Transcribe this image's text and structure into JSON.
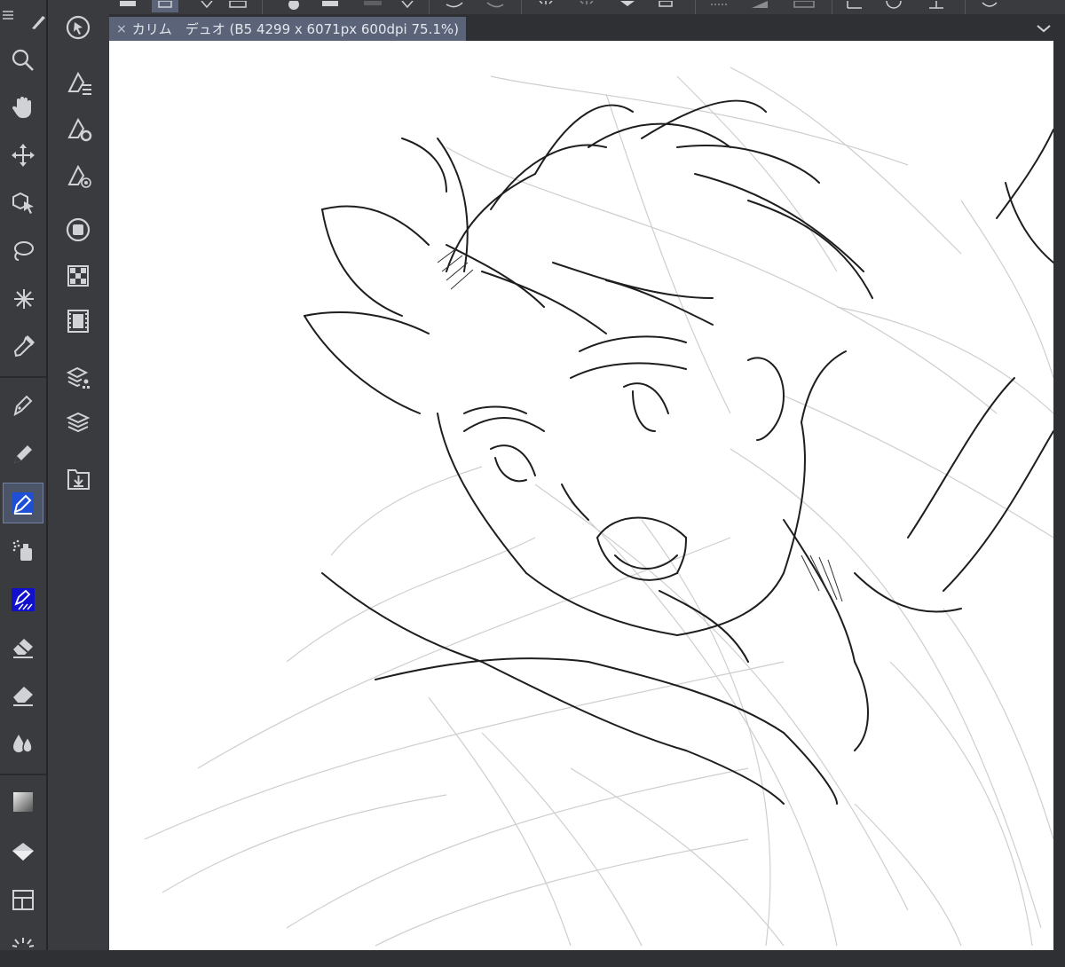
{
  "document_tab": {
    "close_glyph": "×",
    "title": "カリム　デュオ (B5 4299 x 6071px 600dpi 75.1%)"
  },
  "top_toolbar": {
    "icons": [
      "new-file-icon",
      "save-icon",
      "undo-icon",
      "redo-icon",
      "clear-icon",
      "transform-icon",
      "selection-icon",
      "ruler-icon",
      "snap-icon",
      "balloon-icon"
    ]
  },
  "tools": {
    "icons": [
      "zoom-icon",
      "hand-icon",
      "move-icon",
      "object-select-icon",
      "lasso-icon",
      "auto-select-icon",
      "eyedropper-icon",
      "pen-icon",
      "pencil-icon",
      "brush-icon",
      "airbrush-icon",
      "decoration-icon",
      "eraser-icon",
      "blend-icon",
      "fill-icon",
      "gradient-icon",
      "figure-icon",
      "frame-border-icon"
    ],
    "active": "brush-icon"
  },
  "sub_tools": {
    "icons": [
      "tool-property-icon",
      "sub-tool-detail-icon",
      "brush-size-icon",
      "color-wheel-icon",
      "color-set-icon",
      "animation-icon",
      "layer-property-icon",
      "layer-icon",
      "material-icon"
    ]
  },
  "colors": {
    "panel": "#3a3b3e",
    "tab_active": "#5b6378",
    "active_tool": "#4c5568",
    "canvas": "#ffffff",
    "icon": "#d0d2d6",
    "accent_blue": "#1f4fd6"
  }
}
